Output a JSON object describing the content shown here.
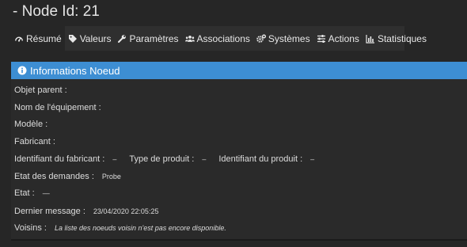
{
  "page": {
    "title": "- Node Id: 21"
  },
  "tabs": [
    {
      "label": "Résumé",
      "icon": "dashboard-icon",
      "active": true
    },
    {
      "label": "Valeurs",
      "icon": "tag-icon"
    },
    {
      "label": "Paramètres",
      "icon": "wrench-icon"
    },
    {
      "label": "Associations",
      "icon": "users-icon"
    },
    {
      "label": "Systèmes",
      "icon": "cogs-icon"
    },
    {
      "label": "Actions",
      "icon": "sliders-icon"
    },
    {
      "label": "Statistiques",
      "icon": "bar-chart-icon"
    }
  ],
  "panel": {
    "title": "Informations Noeud",
    "header_color": "#3d8ed3",
    "fields": {
      "parent_label": "Objet parent :",
      "name_label": "Nom de l'équipement :",
      "model_label": "Modèle :",
      "manufacturer_label": "Fabricant :",
      "manufacturer_id_label": "Identifiant du fabricant :",
      "manufacturer_id_value": "–",
      "product_type_label": "Type de produit :",
      "product_type_value": "–",
      "product_id_label": "Identifiant du produit :",
      "product_id_value": "–",
      "request_state_label": "Etat des demandes :",
      "request_state_value": "Probe",
      "state_label": "Etat :",
      "state_value": "—",
      "last_message_label": "Dernier message :",
      "last_message_value": "23/04/2020 22:05:25",
      "neighbors_label": "Voisins :",
      "neighbors_value": "La liste des noeuds voisin n'est pas encore disponible."
    }
  }
}
